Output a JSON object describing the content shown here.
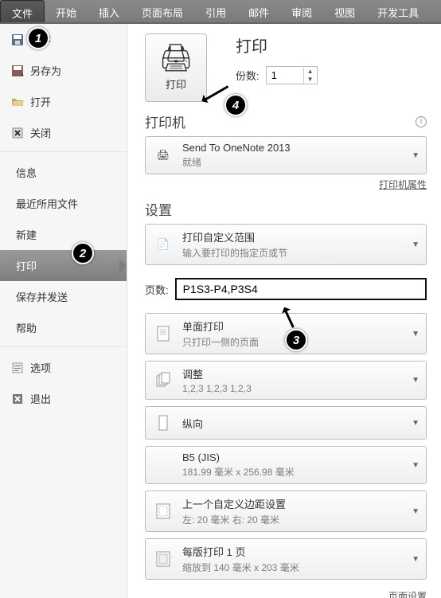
{
  "ribbon": {
    "tabs": [
      "文件",
      "开始",
      "插入",
      "页面布局",
      "引用",
      "邮件",
      "审阅",
      "视图",
      "开发工具"
    ],
    "active": 0
  },
  "sidebar": {
    "items": [
      {
        "icon": "save",
        "label": "保存"
      },
      {
        "icon": "saveas",
        "label": "另存为"
      },
      {
        "icon": "open",
        "label": "打开"
      },
      {
        "icon": "close",
        "label": "关闭"
      }
    ],
    "plain": [
      "信息",
      "最近所用文件",
      "新建",
      "打印",
      "保存并发送",
      "帮助"
    ],
    "selectedPlain": "打印",
    "footer": [
      {
        "icon": "options",
        "label": "选项"
      },
      {
        "icon": "exit",
        "label": "退出"
      }
    ]
  },
  "print": {
    "heading": "打印",
    "button_label": "打印",
    "copies_label": "份数:",
    "copies_value": "1"
  },
  "printer_section": {
    "title": "打印机",
    "selected_name": "Send To OneNote 2013",
    "selected_status": "就绪",
    "properties_link": "打印机属性"
  },
  "settings": {
    "title": "设置",
    "range": {
      "title": "打印自定义范围",
      "sub": "输入要打印的指定页或节"
    },
    "pages_label": "页数:",
    "pages_value": "P1S3-P4,P3S4",
    "duplex": {
      "title": "单面打印",
      "sub": "只打印一侧的页面"
    },
    "collate": {
      "title": "调整",
      "sub": "1,2,3    1,2,3    1,2,3"
    },
    "orientation": {
      "title": "纵向",
      "sub": ""
    },
    "paper": {
      "title": "B5 (JIS)",
      "sub": "181.99 毫米 x 256.98 毫米"
    },
    "margins": {
      "title": "上一个自定义边距设置",
      "sub": "左: 20 毫米   右: 20 毫米"
    },
    "scale": {
      "title": "每版打印 1 页",
      "sub": "缩放到 140 毫米 x 203 毫米"
    },
    "page_setup_link": "页面设置"
  },
  "callouts": {
    "c1": "1",
    "c2": "2",
    "c3": "3",
    "c4": "4"
  }
}
